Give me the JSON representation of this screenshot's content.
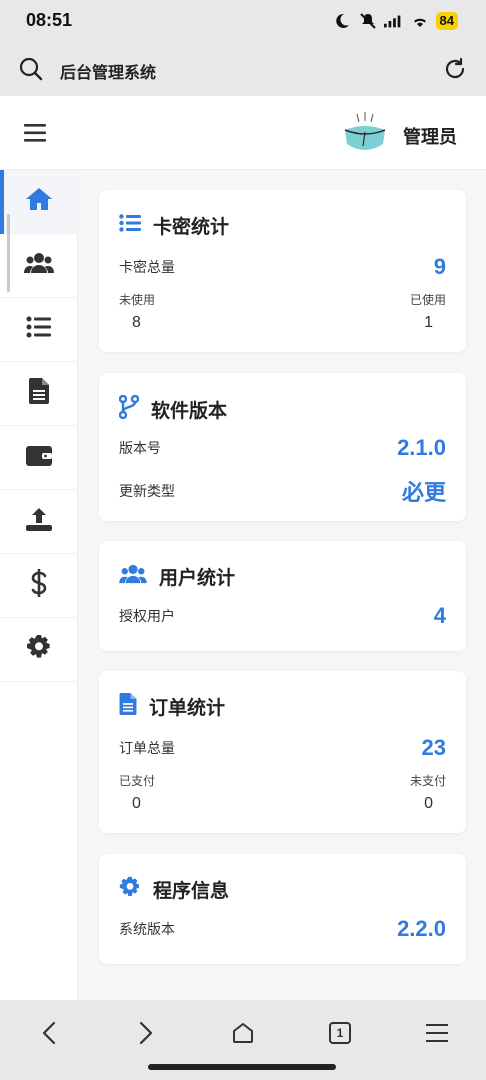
{
  "status_bar": {
    "time": "08:51",
    "battery": "84"
  },
  "browser": {
    "title": "后台管理系统"
  },
  "header": {
    "admin_name": "管理员"
  },
  "sidebar": {
    "items": [
      {
        "icon": "home-icon",
        "active": true
      },
      {
        "icon": "users-icon"
      },
      {
        "icon": "list-icon"
      },
      {
        "icon": "document-icon"
      },
      {
        "icon": "wallet-icon"
      },
      {
        "icon": "upload-icon"
      },
      {
        "icon": "dollar-icon"
      },
      {
        "icon": "gear-icon"
      }
    ]
  },
  "cards": {
    "card_stats": {
      "title": "卡密统计",
      "total_label": "卡密总量",
      "total_value": "9",
      "unused_label": "未使用",
      "unused_value": "8",
      "used_label": "已使用",
      "used_value": "1"
    },
    "software_version": {
      "title": "软件版本",
      "version_label": "版本号",
      "version_value": "2.1.0",
      "update_label": "更新类型",
      "update_value": "必更"
    },
    "user_stats": {
      "title": "用户统计",
      "auth_label": "授权用户",
      "auth_value": "4"
    },
    "order_stats": {
      "title": "订单统计",
      "total_label": "订单总量",
      "total_value": "23",
      "paid_label": "已支付",
      "paid_value": "0",
      "unpaid_label": "未支付",
      "unpaid_value": "0"
    },
    "program_info": {
      "title": "程序信息",
      "sys_label": "系统版本",
      "sys_value": "2.2.0"
    }
  },
  "bottom_nav": {
    "tabs_count": "1"
  },
  "colors": {
    "accent": "#2f7be0",
    "bg": "#f5f6f7"
  }
}
